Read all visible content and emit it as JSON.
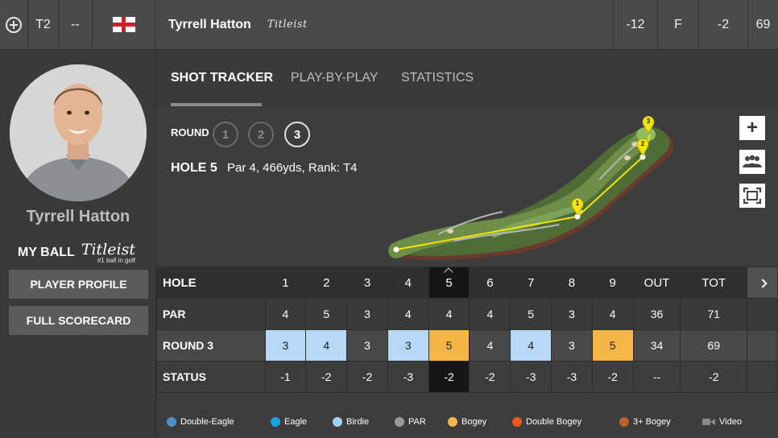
{
  "topbar": {
    "position": "T2",
    "dash": "--",
    "player_name": "Tyrrell Hatton",
    "brand": "Titleist",
    "total_to_par": "-12",
    "thru": "F",
    "today": "-2",
    "score": "69"
  },
  "sidebar": {
    "player_name": "Tyrrell Hatton",
    "my_ball_label": "MY BALL",
    "ball_brand": "Titleist",
    "ball_tagline": "#1 ball in golf",
    "player_profile_label": "PLAYER PROFILE",
    "full_scorecard_label": "FULL SCORECARD"
  },
  "tabs": [
    {
      "label": "SHOT TRACKER",
      "active": true
    },
    {
      "label": "PLAY-BY-PLAY",
      "active": false
    },
    {
      "label": "STATISTICS",
      "active": false
    }
  ],
  "round_selector": {
    "label": "ROUND",
    "rounds": [
      "1",
      "2",
      "3"
    ],
    "active_round": "3"
  },
  "hole_info": {
    "hole": "HOLE 5",
    "details": "Par 4, 466yds, Rank: T4"
  },
  "map_controls": {
    "zoom_in": "+",
    "shot_markers": [
      "1",
      "2",
      "3"
    ]
  },
  "scorecard": {
    "row_labels": {
      "hole": "HOLE",
      "par": "PAR",
      "round": "ROUND 3",
      "status": "STATUS"
    },
    "holes": [
      "1",
      "2",
      "3",
      "4",
      "5",
      "6",
      "7",
      "8",
      "9",
      "OUT",
      "TOT"
    ],
    "par": [
      "4",
      "5",
      "3",
      "4",
      "4",
      "4",
      "5",
      "3",
      "4",
      "36",
      "71"
    ],
    "round3": [
      "3",
      "4",
      "3",
      "3",
      "5",
      "4",
      "4",
      "3",
      "5",
      "34",
      "69"
    ],
    "status": [
      "-1",
      "-2",
      "-2",
      "-3",
      "-2",
      "-2",
      "-3",
      "-3",
      "-2",
      "--",
      "-2"
    ],
    "round3_types": [
      "birdie",
      "birdie",
      "par",
      "birdie",
      "bogey",
      "par",
      "birdie",
      "par",
      "bogey",
      "",
      ""
    ],
    "selected_hole_index": 4
  },
  "legend": [
    {
      "label": "Double-Eagle",
      "color": "#4d90c4"
    },
    {
      "label": "Eagle",
      "color": "#1aa3e0"
    },
    {
      "label": "Birdie",
      "color": "#9fd0f5"
    },
    {
      "label": "PAR",
      "color": "#9a9a9a"
    },
    {
      "label": "Bogey",
      "color": "#f5b547"
    },
    {
      "label": "Double Bogey",
      "color": "#ea5a1c"
    },
    {
      "label": "3+ Bogey",
      "color": "#b5622b"
    },
    {
      "label": "Video",
      "color": "#8a8a8a"
    }
  ]
}
